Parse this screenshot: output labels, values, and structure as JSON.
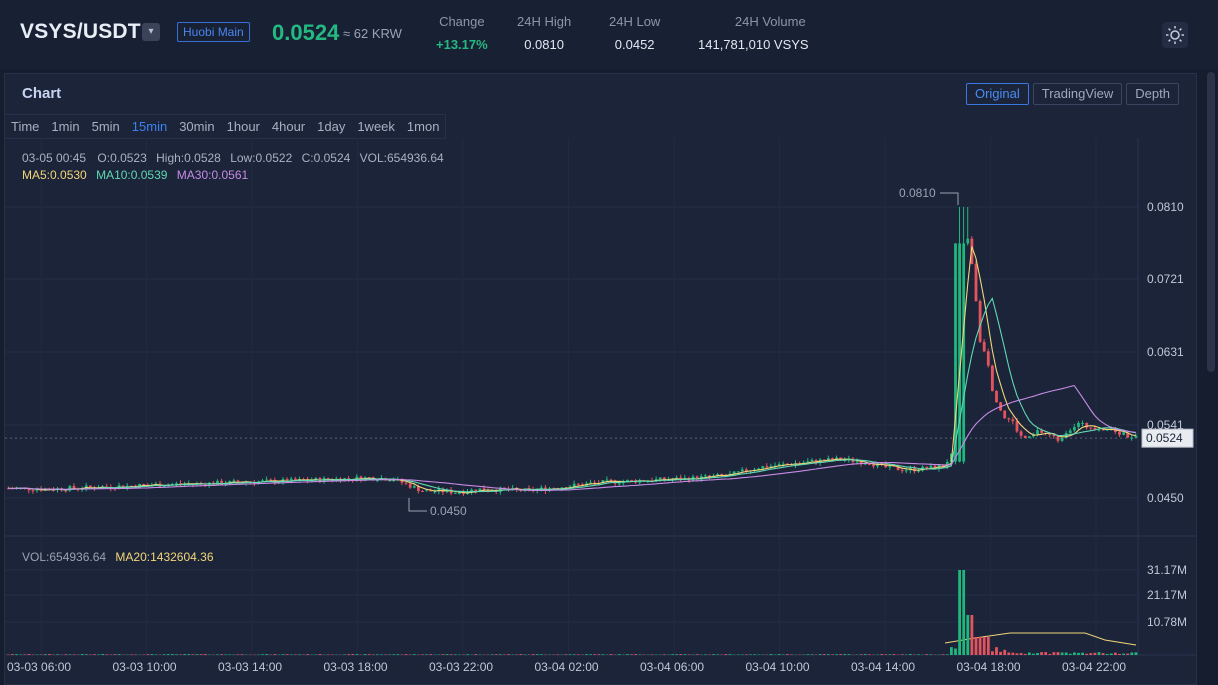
{
  "header": {
    "pair": "VSYS/USDT",
    "market": "Huobi Main",
    "last_price": "0.0524",
    "fiat_equiv": "≈ 62 KRW",
    "stats": [
      {
        "label": "Change",
        "value": "+13.17%",
        "up": true
      },
      {
        "label": "24H High",
        "value": "0.0810"
      },
      {
        "label": "24H Low",
        "value": "0.0452"
      },
      {
        "label": "24H Volume",
        "value": "141,781,010 VSYS"
      }
    ]
  },
  "panel": {
    "title": "Chart",
    "view_tabs": [
      "Original",
      "TradingView",
      "Depth"
    ],
    "active_view": "Original",
    "intervals": [
      "Time",
      "1min",
      "5min",
      "15min",
      "30min",
      "1hour",
      "4hour",
      "1day",
      "1week",
      "1mon"
    ],
    "active_interval": "15min"
  },
  "chart_data": {
    "type": "candlestick",
    "legend": {
      "ohlc": {
        "date": "03-05 00:45",
        "open": "O:0.0523",
        "high": "High:0.0528",
        "low": "Low:0.0522",
        "close": "C:0.0524",
        "vol": "VOL:654936.64"
      },
      "ma": [
        {
          "label": "MA5:0.0530",
          "color": "#f3d67a"
        },
        {
          "label": "MA10:0.0539",
          "color": "#5fd8b5"
        },
        {
          "label": "MA30:0.0561",
          "color": "#c88be6"
        }
      ],
      "volume": [
        {
          "label": "VOL:654936.64",
          "color": "#9aa3b6"
        },
        {
          "label": "MA20:1432604.36",
          "color": "#f3d67a"
        }
      ]
    },
    "price_axis": {
      "ticks": [
        "0.0810",
        "0.0721",
        "0.0631",
        "0.0541",
        "0.0450"
      ],
      "current": "0.0524"
    },
    "volume_axis": {
      "ticks": [
        "31.17M",
        "21.17M",
        "10.78M"
      ]
    },
    "time_axis": [
      "03-03 06:00",
      "03-03 10:00",
      "03-03 14:00",
      "03-03 18:00",
      "03-03 22:00",
      "03-04 02:00",
      "03-04 06:00",
      "03-04 10:00",
      "03-04 14:00",
      "03-04 18:00",
      "03-04 22:00"
    ],
    "annotations": {
      "high": "0.0810",
      "low": "0.0450"
    },
    "price_path": [
      [
        0,
        0.0462
      ],
      [
        40,
        0.0461
      ],
      [
        80,
        0.0463
      ],
      [
        120,
        0.0465
      ],
      [
        160,
        0.0467
      ],
      [
        200,
        0.0468
      ],
      [
        240,
        0.047
      ],
      [
        280,
        0.0471
      ],
      [
        320,
        0.0473
      ],
      [
        360,
        0.0475
      ],
      [
        384,
        0.0474
      ],
      [
        400,
        0.0466
      ],
      [
        416,
        0.0458
      ],
      [
        430,
        0.0459
      ],
      [
        450,
        0.0457
      ],
      [
        470,
        0.0461
      ],
      [
        500,
        0.046
      ],
      [
        520,
        0.0459
      ],
      [
        540,
        0.0462
      ],
      [
        560,
        0.0465
      ],
      [
        600,
        0.047
      ],
      [
        640,
        0.0472
      ],
      [
        680,
        0.0474
      ],
      [
        720,
        0.0478
      ],
      [
        750,
        0.0488
      ],
      [
        780,
        0.0492
      ],
      [
        810,
        0.0496
      ],
      [
        830,
        0.0498
      ],
      [
        860,
        0.0494
      ],
      [
        880,
        0.0487
      ],
      [
        900,
        0.0485
      ],
      [
        920,
        0.0487
      ],
      [
        935,
        0.049
      ],
      [
        945,
        0.0505
      ],
      [
        952,
        0.052
      ],
      [
        956,
        0.0765
      ],
      [
        960,
        0.077
      ],
      [
        966,
        0.0715
      ],
      [
        972,
        0.064
      ],
      [
        978,
        0.063
      ],
      [
        984,
        0.0585
      ],
      [
        990,
        0.0565
      ],
      [
        996,
        0.055
      ],
      [
        1004,
        0.0545
      ],
      [
        1012,
        0.0526
      ],
      [
        1020,
        0.0523
      ],
      [
        1030,
        0.0533
      ],
      [
        1040,
        0.0528
      ],
      [
        1050,
        0.0522
      ],
      [
        1060,
        0.0535
      ],
      [
        1070,
        0.0542
      ],
      [
        1080,
        0.0538
      ],
      [
        1090,
        0.0537
      ],
      [
        1100,
        0.0535
      ],
      [
        1110,
        0.0531
      ],
      [
        1120,
        0.0527
      ],
      [
        1130,
        0.0524
      ]
    ]
  }
}
